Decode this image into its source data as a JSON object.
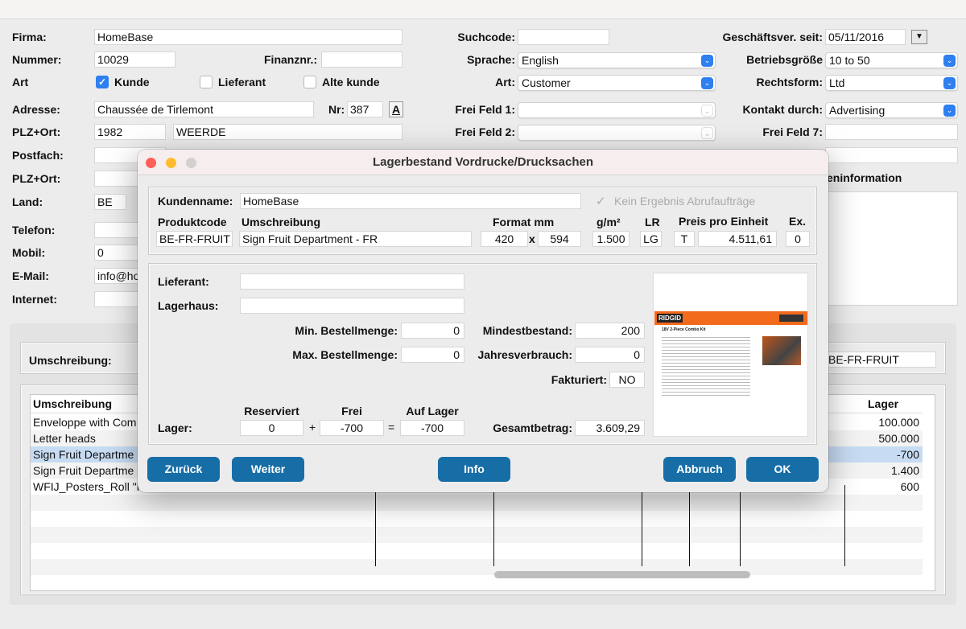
{
  "form": {
    "firma": {
      "label": "Firma:",
      "value": "HomeBase"
    },
    "nummer": {
      "label": "Nummer:",
      "value": "10029"
    },
    "finanznr": {
      "label": "Finanznr.:",
      "value": ""
    },
    "art": {
      "label": "Art",
      "kunde": "Kunde",
      "lieferant": "Lieferant",
      "alte_kunde": "Alte kunde",
      "kunde_checked": true,
      "lieferant_checked": false,
      "alte_kunde_checked": false
    },
    "adresse": {
      "label": "Adresse:",
      "value": "Chaussée de Tirlemont"
    },
    "nr": {
      "label": "Nr:",
      "value": "387",
      "button": "A"
    },
    "plz_ort": {
      "label": "PLZ+Ort:",
      "plz": "1982",
      "ort": "WEERDE"
    },
    "postfach": {
      "label": "Postfach:"
    },
    "plz_ort2": {
      "label": "PLZ+Ort:"
    },
    "land": {
      "label": "Land:",
      "value": "BE"
    },
    "telefon": {
      "label": "Telefon:"
    },
    "mobil": {
      "label": "Mobil:",
      "value": "0"
    },
    "email": {
      "label": "E-Mail:",
      "value": "info@ho"
    },
    "internet": {
      "label": "Internet:"
    },
    "suchcode": {
      "label": "Suchcode:",
      "value": ""
    },
    "sprache": {
      "label": "Sprache:",
      "value": "English"
    },
    "art2": {
      "label": "Art:",
      "value": "Customer"
    },
    "frei1": {
      "label": "Frei Feld 1:",
      "value": ""
    },
    "frei2": {
      "label": "Frei Feld 2:",
      "value": ""
    },
    "seit": {
      "label": "Geschäftsver. seit:",
      "value": "05/11/2016"
    },
    "betrieb": {
      "label": "Betriebsgröße",
      "value": "10 to 50"
    },
    "rechtsform": {
      "label": "Rechtsform:",
      "value": "Ltd"
    },
    "kontakt": {
      "label": "Kontakt durch:",
      "value": "Advertising"
    },
    "frei7": {
      "label": "Frei Feld 7:",
      "value": ""
    },
    "info_label": "eninformation"
  },
  "bottom": {
    "umschreibung_label": "Umschreibung:",
    "code_value": "BE-FR-FRUIT",
    "columns": {
      "umschreibung": "Umschreibung",
      "lager": "Lager"
    },
    "rows": [
      {
        "umschreibung": "Enveloppe with Com",
        "lager": "100.000"
      },
      {
        "umschreibung": "Letter heads",
        "lager": "500.000"
      },
      {
        "umschreibung": "Sign Fruit Departme",
        "lager": "-700",
        "selected": true
      },
      {
        "umschreibung": "Sign Fruit Departme",
        "lager": "1.400"
      },
      {
        "umschreibung": "WFIJ_Posters_Roll \"P",
        "lager": "600"
      }
    ]
  },
  "dialog": {
    "title": "Lagerbestand Vordrucke/Drucksachen",
    "kundenname": {
      "label": "Kundenname:",
      "value": "HomeBase"
    },
    "kein_ergebnis": {
      "label": "Kein Ergebnis Abrufaufträge",
      "checked": true,
      "disabled": true
    },
    "headers": {
      "produktcode": "Produktcode",
      "umschreibung": "Umschreibung",
      "format": "Format mm",
      "gm2": "g/m²",
      "lr": "LR",
      "preis": "Preis pro Einheit",
      "ex": "Ex."
    },
    "values": {
      "produktcode": "BE-FR-FRUIT",
      "umschreibung": "Sign Fruit Department - FR",
      "format_w": "420",
      "x": "x",
      "format_h": "594",
      "gm2": "1.500",
      "lr": "LG",
      "t": "T",
      "preis": "4.511,61",
      "ex": "0"
    },
    "lieferant": {
      "label": "Lieferant:",
      "value": ""
    },
    "lagerhaus": {
      "label": "Lagerhaus:",
      "value": ""
    },
    "min_bestell": {
      "label": "Min. Bestellmenge:",
      "value": "0"
    },
    "max_bestell": {
      "label": "Max. Bestellmenge:",
      "value": "0"
    },
    "mindestbestand": {
      "label": "Mindestbestand:",
      "value": "200"
    },
    "jahresverbrauch": {
      "label": "Jahresverbrauch:",
      "value": "0"
    },
    "fakturiert": {
      "label": "Fakturiert:",
      "value": "NO"
    },
    "lager": {
      "label": "Lager:",
      "reserviert_label": "Reserviert",
      "frei_label": "Frei",
      "auf_lager_label": "Auf Lager",
      "reserviert": "0",
      "plus": "+",
      "frei": "-700",
      "equals": "=",
      "auf_lager": "-700"
    },
    "gesamtbetrag": {
      "label": "Gesamtbetrag:",
      "value": "3.609,29"
    },
    "image": {
      "brand": "RIDGID",
      "heading": "18V 2-Piece Combo Kit"
    },
    "buttons": {
      "zurueck": "Zurück",
      "weiter": "Weiter",
      "info": "Info",
      "abbruch": "Abbruch",
      "ok": "OK"
    }
  },
  "colors": {
    "button": "#176ea7",
    "select_arrow": "#2e7ff0",
    "selected_row": "#c7dcf3",
    "flyer_orange": "#f26b1d"
  }
}
